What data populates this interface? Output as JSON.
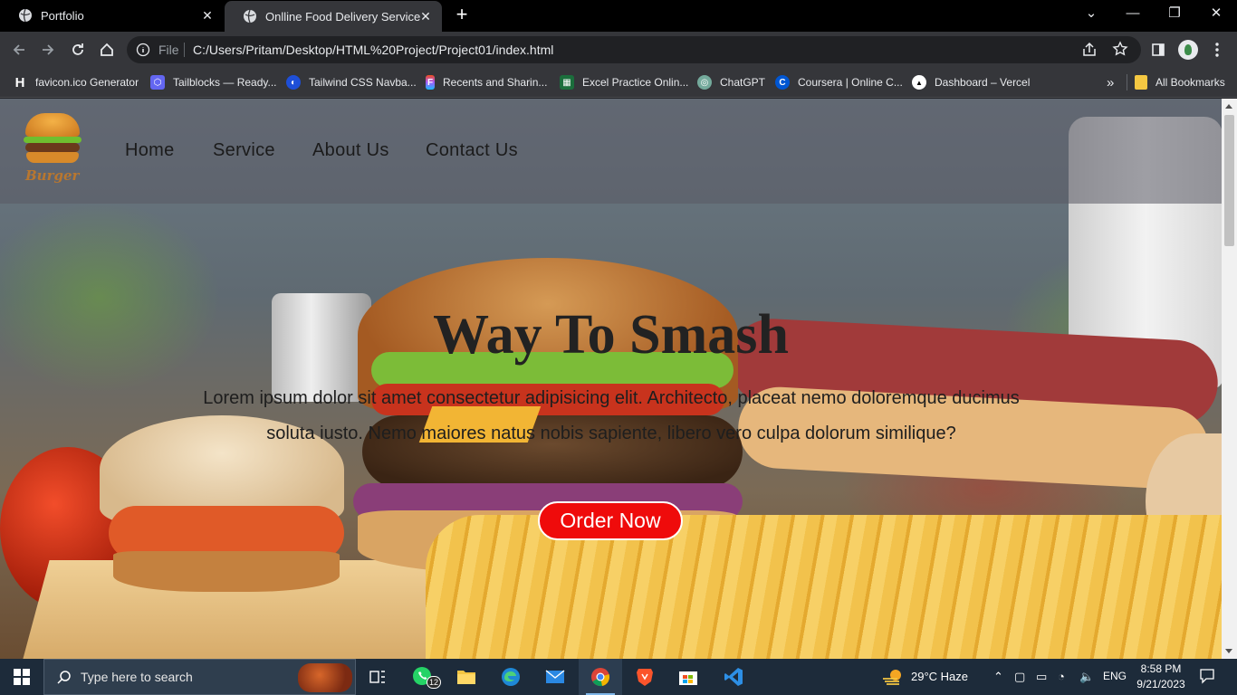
{
  "browser": {
    "tabs": [
      {
        "title": "Portfolio"
      },
      {
        "title": "Onlline Food Delivery Service | W"
      }
    ],
    "address": {
      "scheme": "File",
      "url": "C:/Users/Pritam/Desktop/HTML%20Project/Project01/index.html"
    },
    "bookmarks": [
      {
        "label": "favicon.ico Generator",
        "icon_letter": "H",
        "color": "#000000"
      },
      {
        "label": "Tailblocks — Ready...",
        "icon_letter": "⬡",
        "color": "#6366f1"
      },
      {
        "label": "Tailwind CSS Navba...",
        "icon_letter": "◐",
        "color": "#1e4fd8"
      },
      {
        "label": "Recents and Sharin...",
        "icon_letter": "F",
        "color": "#a259ff"
      },
      {
        "label": "Excel Practice Onlin...",
        "icon_letter": "▦",
        "color": "#1b6e3c"
      },
      {
        "label": "ChatGPT",
        "icon_letter": "◎",
        "color": "#74aa9c"
      },
      {
        "label": "Coursera | Online C...",
        "icon_letter": "C",
        "color": "#0056d2"
      },
      {
        "label": "Dashboard – Vercel",
        "icon_letter": "▲",
        "color": "#000000"
      }
    ],
    "bookmarks_more": "»",
    "all_bookmarks": "All Bookmarks"
  },
  "page": {
    "logo_text": "Burger",
    "nav": [
      "Home",
      "Service",
      "About Us",
      "Contact Us"
    ],
    "headline": "Way To Smash",
    "lead": "Lorem ipsum dolor sit amet consectetur adipisicing elit. Architecto, placeat nemo doloremque ducimus soluta iusto. Nemo maiores natus nobis sapiente, libero vero culpa dolorum similique?",
    "cta": "Order Now",
    "colors": {
      "cta": "#ef0b0b",
      "headline": "#222222"
    }
  },
  "taskbar": {
    "search_placeholder": "Type here to search",
    "whatsapp_badge": "12",
    "weather": "29°C  Haze",
    "language": "ENG",
    "time": "8:58 PM",
    "date": "9/21/2023"
  }
}
